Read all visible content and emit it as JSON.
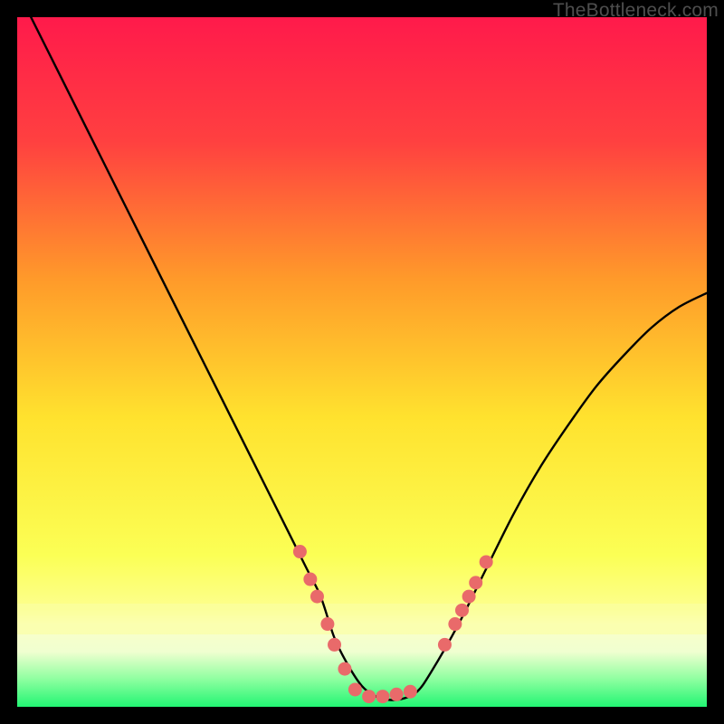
{
  "watermark": "TheBottleneck.com",
  "chart_data": {
    "type": "line",
    "title": "",
    "xlabel": "",
    "ylabel": "",
    "xlim": [
      0,
      100
    ],
    "ylim": [
      0,
      100
    ],
    "background_gradient": {
      "top": "#ff1a4b",
      "mid_upper": "#ff7f2a",
      "mid": "#ffe92e",
      "mid_lower": "#fdff7a",
      "band": "#fbffa3",
      "bottom": "#2bf87a"
    },
    "series": [
      {
        "name": "curve",
        "type": "line",
        "stroke": "#000000",
        "x": [
          2,
          6,
          10,
          14,
          18,
          22,
          26,
          30,
          34,
          38,
          42,
          44,
          46,
          48,
          50,
          52,
          54,
          56,
          58,
          60,
          64,
          68,
          72,
          76,
          80,
          84,
          88,
          92,
          96,
          100
        ],
        "y": [
          100,
          92,
          84,
          76,
          68,
          60,
          52,
          44,
          36,
          28,
          20,
          16,
          10,
          6,
          3,
          1.5,
          1,
          1.2,
          2.2,
          5,
          12,
          20,
          28,
          35,
          41,
          46.5,
          51,
          55,
          58,
          60
        ]
      },
      {
        "name": "dots-left",
        "type": "scatter",
        "color": "#e96a6a",
        "x": [
          41,
          42.5,
          43.5,
          45,
          46,
          47.5
        ],
        "y": [
          22.5,
          18.5,
          16,
          12,
          9,
          5.5
        ]
      },
      {
        "name": "dots-bottom",
        "type": "scatter",
        "color": "#e96a6a",
        "x": [
          49,
          51,
          53,
          55,
          57
        ],
        "y": [
          2.5,
          1.5,
          1.5,
          1.8,
          2.2
        ]
      },
      {
        "name": "dots-right",
        "type": "scatter",
        "color": "#e96a6a",
        "x": [
          62,
          63.5,
          64.5,
          65.5,
          66.5,
          68
        ],
        "y": [
          9,
          12,
          14,
          16,
          18,
          21
        ]
      }
    ]
  }
}
